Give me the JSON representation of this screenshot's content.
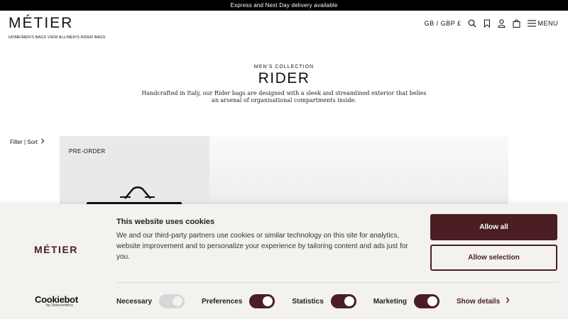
{
  "topbar": {
    "text": "Express and Next Day delivery available"
  },
  "header": {
    "logo": "MÉTIER",
    "breadcrumb": [
      "HOME",
      "/",
      "MEN'S BAGS VIEW ALL",
      "/",
      "MEN'S RIDER BAGS"
    ],
    "locale": "GB / GBP £",
    "menu_label": "MENU",
    "icons": [
      "search-icon",
      "bookmark-icon",
      "user-icon",
      "bag-icon",
      "hamburger-icon"
    ]
  },
  "collection": {
    "kicker": "MEN'S COLLECTION",
    "title": "RIDER",
    "description": "Handcrafted in Italy, our Rider bags are designed with a sleek and streamlined exterior that belies an arsenal of organisational compartments inside."
  },
  "listing": {
    "filter_label": "Filter | Sort",
    "product_badge": "PRE-ORDER"
  },
  "cookie": {
    "brand": "MÉTIER",
    "title": "This website uses cookies",
    "text": "We and our third-party partners use cookies or similar technology on this site for analytics, website improvement and to personalize your experience by tailoring content and ads just for you.",
    "allow_all": "Allow all",
    "allow_selection": "Allow selection",
    "provider": "Cookiebot",
    "provider_by": "by Usercentrics",
    "toggles": [
      {
        "label": "Necessary",
        "on": false
      },
      {
        "label": "Preferences",
        "on": true
      },
      {
        "label": "Statistics",
        "on": true
      },
      {
        "label": "Marketing",
        "on": true
      }
    ],
    "show_details": "Show details"
  },
  "colors": {
    "accent": "#4a1e22",
    "topbar": "#000000",
    "banner_bg": "#f3f2ee"
  }
}
